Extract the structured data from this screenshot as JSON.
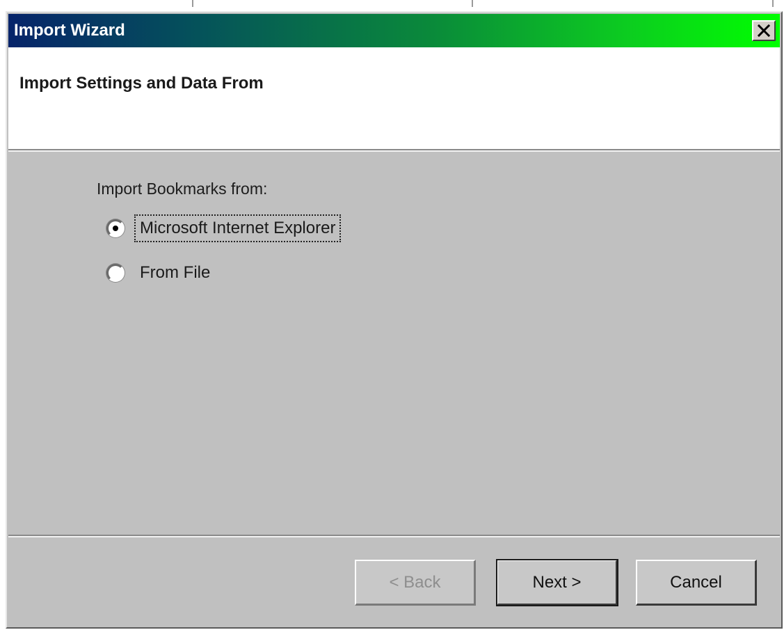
{
  "window": {
    "title": "Import Wizard",
    "close_glyph": "✕",
    "titlebar_gradient": [
      "#06246a",
      "#05535a",
      "#0a8a3a",
      "#0ccc20",
      "#00ff00"
    ]
  },
  "header": {
    "title": "Import Settings and Data From"
  },
  "body": {
    "prompt": "Import Bookmarks from:",
    "options": [
      {
        "label": "Microsoft Internet Explorer",
        "selected": true
      },
      {
        "label": "From File",
        "selected": false
      }
    ]
  },
  "buttons": {
    "back": {
      "label": "< Back",
      "enabled": false
    },
    "next": {
      "label": "Next >",
      "enabled": true,
      "default": true
    },
    "cancel": {
      "label": "Cancel",
      "enabled": true
    }
  },
  "colors": {
    "dialog_background": "#c0c0c0",
    "header_background": "#ffffff"
  }
}
